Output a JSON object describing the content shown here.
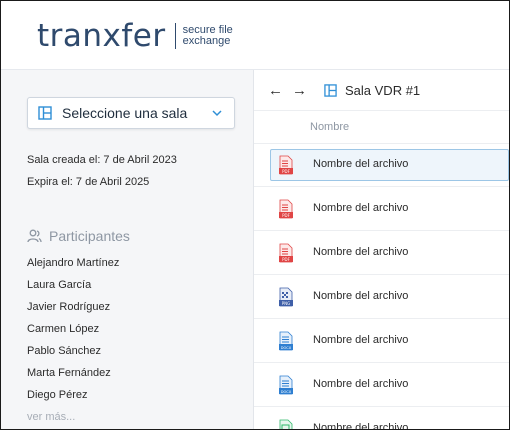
{
  "header": {
    "logo_word": "tranxfer",
    "logo_tag_line1": "secure file",
    "logo_tag_line2": "exchange"
  },
  "sidebar": {
    "room_select": {
      "label": "Seleccione una sala"
    },
    "created": "Sala creada el: 7 de Abril 2023",
    "expires": "Expira el: 7 de Abril 2025",
    "participants_title": "Participantes",
    "participants": [
      "Alejandro Martínez",
      "Laura García",
      "Javier Rodríguez",
      "Carmen López",
      "Pablo Sánchez",
      "Marta Fernández",
      "Diego Pérez"
    ],
    "more_label": "ver más..."
  },
  "main": {
    "breadcrumb": "Sala VDR #1",
    "column_header": "Nombre",
    "files": [
      {
        "name": "Nombre del archivo",
        "type": "PDF",
        "selected": true
      },
      {
        "name": "Nombre del archivo",
        "type": "PDF",
        "selected": false
      },
      {
        "name": "Nombre del archivo",
        "type": "PDF",
        "selected": false
      },
      {
        "name": "Nombre del archivo",
        "type": "PNG",
        "selected": false
      },
      {
        "name": "Nombre del archivo",
        "type": "DOCX",
        "selected": false
      },
      {
        "name": "Nombre del archivo",
        "type": "DOCX",
        "selected": false
      },
      {
        "name": "Nombre del archivo",
        "type": "XLS",
        "selected": false
      }
    ]
  },
  "colors": {
    "brand": "#2f4a6d",
    "accent_blue": "#2f8fd6",
    "pdf_red": "#e04545",
    "png_blue": "#3f5fa8",
    "docx_blue": "#2f7fd1",
    "xls_green": "#2fb86a",
    "selected_border": "#9cc6e6",
    "selected_bg": "#eef5fb"
  },
  "icons": {
    "room": "layout-icon",
    "chevron": "chevron-down-icon",
    "participants": "users-icon",
    "back": "arrow-left-icon",
    "forward": "arrow-right-icon"
  }
}
